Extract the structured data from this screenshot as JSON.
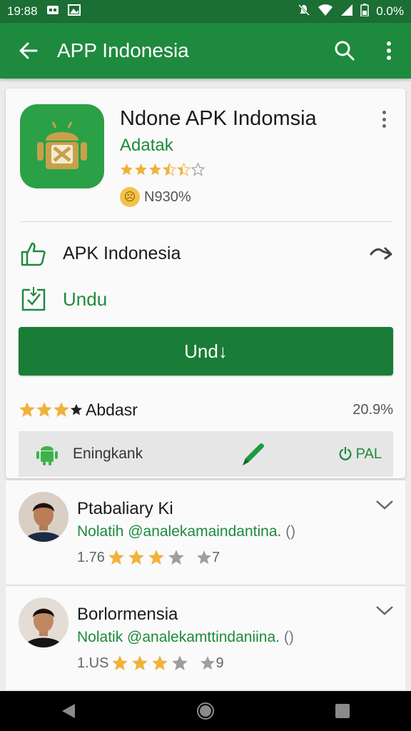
{
  "status_bar": {
    "time": "19:88",
    "battery": "0.0%"
  },
  "app_bar": {
    "title": "APP Indonesia"
  },
  "app": {
    "name": "Ndone APK Indomsia",
    "developer": "Adatak",
    "rating_stars": 3.5,
    "size": "N930%"
  },
  "rows": {
    "share_label": "APK Indonesia",
    "download_label": "Undu"
  },
  "install_button": {
    "label": "Und↓"
  },
  "rating": {
    "label": "Abdasr",
    "percent": "20.9%"
  },
  "info_strip": {
    "label": "Eningkank",
    "pal_label": "PAL"
  },
  "reviews": [
    {
      "name": "Ptabaliary Ki",
      "text": "Nolatih @analekamaindantina.",
      "count_mark": "()",
      "votes": "1.76",
      "stars": 3,
      "trailing": "7"
    },
    {
      "name": "Borlormensia",
      "text": "Nolatik @analekamttindaniina.",
      "count_mark": "()",
      "votes": "1.US",
      "stars": 3,
      "trailing": "9"
    }
  ],
  "colors": {
    "status_bar": "#1b6e34",
    "app_bar": "#1e8a3e",
    "accent": "#1e8a3e",
    "button": "#1a7d37",
    "star": "#f0b23a"
  }
}
